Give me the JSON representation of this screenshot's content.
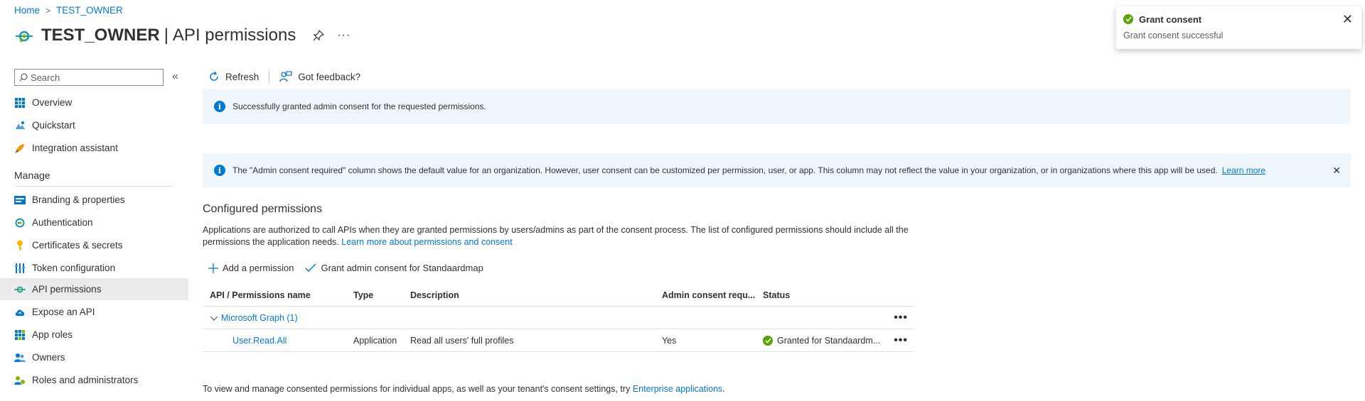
{
  "breadcrumb": {
    "home": "Home",
    "separator": ">",
    "current": "TEST_OWNER"
  },
  "title": {
    "app_name": "TEST_OWNER",
    "separator": "|",
    "page": "API permissions",
    "more": "···"
  },
  "sidebar": {
    "search_placeholder": "Search",
    "collapse": "«",
    "items_top": [
      {
        "label": "Overview",
        "icon": "overview-icon"
      },
      {
        "label": "Quickstart",
        "icon": "quickstart-icon"
      },
      {
        "label": "Integration assistant",
        "icon": "rocket-icon"
      }
    ],
    "manage_heading": "Manage",
    "items_manage": [
      {
        "label": "Branding & properties",
        "icon": "branding-icon"
      },
      {
        "label": "Authentication",
        "icon": "authentication-icon"
      },
      {
        "label": "Certificates & secrets",
        "icon": "key-icon"
      },
      {
        "label": "Token configuration",
        "icon": "token-config-icon"
      },
      {
        "label": "API permissions",
        "icon": "api-permissions-icon",
        "active": true
      },
      {
        "label": "Expose an API",
        "icon": "cloud-icon"
      },
      {
        "label": "App roles",
        "icon": "app-roles-icon"
      },
      {
        "label": "Owners",
        "icon": "owners-icon"
      },
      {
        "label": "Roles and administrators",
        "icon": "roles-admin-icon"
      }
    ]
  },
  "toolbar": {
    "refresh": "Refresh",
    "feedback": "Got feedback?"
  },
  "banner_success": {
    "text": "Successfully granted admin consent for the requested permissions."
  },
  "banner_info": {
    "text": "The \"Admin consent required\" column shows the default value for an organization. However, user consent can be customized per permission, user, or app. This column may not reflect the value in your organization, or in organizations where this app will be used.",
    "link": "Learn more",
    "close": "✕"
  },
  "configured": {
    "title": "Configured permissions",
    "desc": "Applications are authorized to call APIs when they are granted permissions by users/admins as part of the consent process. The list of configured permissions should include all the permissions the application needs.",
    "desc_link": "Learn more about permissions and consent"
  },
  "actions": {
    "add": "Add a permission",
    "grant": "Grant admin consent for Standaardmap"
  },
  "table": {
    "headers": [
      "API / Permissions name",
      "Type",
      "Description",
      "Admin consent requ...",
      "Status"
    ],
    "group": {
      "label": "Microsoft Graph (1)",
      "dots": "•••"
    },
    "rows": [
      {
        "name": "User.Read.All",
        "type": "Application",
        "description": "Read all users' full profiles",
        "admin": "Yes",
        "status": "Granted for Standaardm...",
        "dots": "•••"
      }
    ]
  },
  "footer": {
    "text": "To view and manage consented permissions for individual apps, as well as your tenant's consent settings, try",
    "link": "Enterprise applications",
    "end": "."
  },
  "toast": {
    "title": "Grant consent",
    "message": "Grant consent successful",
    "close": "✕"
  },
  "colors": {
    "accent": "#0078d4",
    "success": "#57a300",
    "banner_bg": "#eff6fc"
  }
}
